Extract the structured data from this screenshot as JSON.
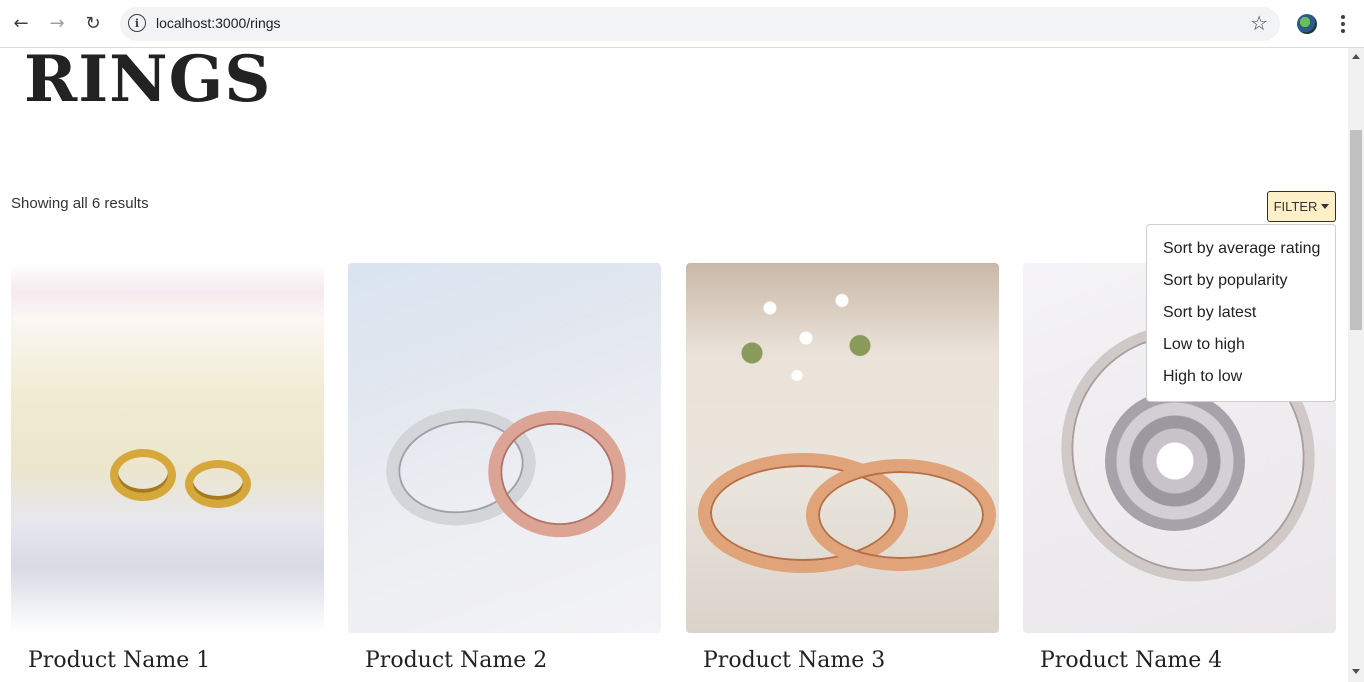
{
  "browser": {
    "url": "localhost:3000/rings",
    "back_icon": "←",
    "forward_icon": "→",
    "reload_icon": "↻",
    "star_icon": "☆"
  },
  "page": {
    "title": "RINGS",
    "results_text": "Showing all 6 results",
    "filter_label": "FILTER",
    "filter_color": "#fdf0c8"
  },
  "filter_menu": [
    {
      "label": "Sort by average rating"
    },
    {
      "label": "Sort by popularity"
    },
    {
      "label": "Sort by latest"
    },
    {
      "label": "Low to high"
    },
    {
      "label": "High to low"
    }
  ],
  "products": [
    {
      "name": "Product Name 1"
    },
    {
      "name": "Product Name 2"
    },
    {
      "name": "Product Name 3"
    },
    {
      "name": "Product Name 4"
    }
  ]
}
